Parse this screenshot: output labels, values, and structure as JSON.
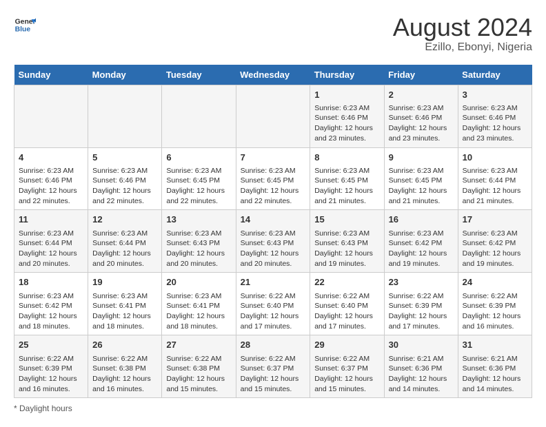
{
  "header": {
    "logo_general": "General",
    "logo_blue": "Blue",
    "main_title": "August 2024",
    "subtitle": "Ezillo, Ebonyi, Nigeria"
  },
  "calendar": {
    "days_of_week": [
      "Sunday",
      "Monday",
      "Tuesday",
      "Wednesday",
      "Thursday",
      "Friday",
      "Saturday"
    ],
    "weeks": [
      [
        {
          "day": "",
          "info": ""
        },
        {
          "day": "",
          "info": ""
        },
        {
          "day": "",
          "info": ""
        },
        {
          "day": "",
          "info": ""
        },
        {
          "day": "1",
          "info": "Sunrise: 6:23 AM\nSunset: 6:46 PM\nDaylight: 12 hours and 23 minutes."
        },
        {
          "day": "2",
          "info": "Sunrise: 6:23 AM\nSunset: 6:46 PM\nDaylight: 12 hours and 23 minutes."
        },
        {
          "day": "3",
          "info": "Sunrise: 6:23 AM\nSunset: 6:46 PM\nDaylight: 12 hours and 23 minutes."
        }
      ],
      [
        {
          "day": "4",
          "info": "Sunrise: 6:23 AM\nSunset: 6:46 PM\nDaylight: 12 hours and 22 minutes."
        },
        {
          "day": "5",
          "info": "Sunrise: 6:23 AM\nSunset: 6:46 PM\nDaylight: 12 hours and 22 minutes."
        },
        {
          "day": "6",
          "info": "Sunrise: 6:23 AM\nSunset: 6:45 PM\nDaylight: 12 hours and 22 minutes."
        },
        {
          "day": "7",
          "info": "Sunrise: 6:23 AM\nSunset: 6:45 PM\nDaylight: 12 hours and 22 minutes."
        },
        {
          "day": "8",
          "info": "Sunrise: 6:23 AM\nSunset: 6:45 PM\nDaylight: 12 hours and 21 minutes."
        },
        {
          "day": "9",
          "info": "Sunrise: 6:23 AM\nSunset: 6:45 PM\nDaylight: 12 hours and 21 minutes."
        },
        {
          "day": "10",
          "info": "Sunrise: 6:23 AM\nSunset: 6:44 PM\nDaylight: 12 hours and 21 minutes."
        }
      ],
      [
        {
          "day": "11",
          "info": "Sunrise: 6:23 AM\nSunset: 6:44 PM\nDaylight: 12 hours and 20 minutes."
        },
        {
          "day": "12",
          "info": "Sunrise: 6:23 AM\nSunset: 6:44 PM\nDaylight: 12 hours and 20 minutes."
        },
        {
          "day": "13",
          "info": "Sunrise: 6:23 AM\nSunset: 6:43 PM\nDaylight: 12 hours and 20 minutes."
        },
        {
          "day": "14",
          "info": "Sunrise: 6:23 AM\nSunset: 6:43 PM\nDaylight: 12 hours and 20 minutes."
        },
        {
          "day": "15",
          "info": "Sunrise: 6:23 AM\nSunset: 6:43 PM\nDaylight: 12 hours and 19 minutes."
        },
        {
          "day": "16",
          "info": "Sunrise: 6:23 AM\nSunset: 6:42 PM\nDaylight: 12 hours and 19 minutes."
        },
        {
          "day": "17",
          "info": "Sunrise: 6:23 AM\nSunset: 6:42 PM\nDaylight: 12 hours and 19 minutes."
        }
      ],
      [
        {
          "day": "18",
          "info": "Sunrise: 6:23 AM\nSunset: 6:42 PM\nDaylight: 12 hours and 18 minutes."
        },
        {
          "day": "19",
          "info": "Sunrise: 6:23 AM\nSunset: 6:41 PM\nDaylight: 12 hours and 18 minutes."
        },
        {
          "day": "20",
          "info": "Sunrise: 6:23 AM\nSunset: 6:41 PM\nDaylight: 12 hours and 18 minutes."
        },
        {
          "day": "21",
          "info": "Sunrise: 6:22 AM\nSunset: 6:40 PM\nDaylight: 12 hours and 17 minutes."
        },
        {
          "day": "22",
          "info": "Sunrise: 6:22 AM\nSunset: 6:40 PM\nDaylight: 12 hours and 17 minutes."
        },
        {
          "day": "23",
          "info": "Sunrise: 6:22 AM\nSunset: 6:39 PM\nDaylight: 12 hours and 17 minutes."
        },
        {
          "day": "24",
          "info": "Sunrise: 6:22 AM\nSunset: 6:39 PM\nDaylight: 12 hours and 16 minutes."
        }
      ],
      [
        {
          "day": "25",
          "info": "Sunrise: 6:22 AM\nSunset: 6:39 PM\nDaylight: 12 hours and 16 minutes."
        },
        {
          "day": "26",
          "info": "Sunrise: 6:22 AM\nSunset: 6:38 PM\nDaylight: 12 hours and 16 minutes."
        },
        {
          "day": "27",
          "info": "Sunrise: 6:22 AM\nSunset: 6:38 PM\nDaylight: 12 hours and 15 minutes."
        },
        {
          "day": "28",
          "info": "Sunrise: 6:22 AM\nSunset: 6:37 PM\nDaylight: 12 hours and 15 minutes."
        },
        {
          "day": "29",
          "info": "Sunrise: 6:22 AM\nSunset: 6:37 PM\nDaylight: 12 hours and 15 minutes."
        },
        {
          "day": "30",
          "info": "Sunrise: 6:21 AM\nSunset: 6:36 PM\nDaylight: 12 hours and 14 minutes."
        },
        {
          "day": "31",
          "info": "Sunrise: 6:21 AM\nSunset: 6:36 PM\nDaylight: 12 hours and 14 minutes."
        }
      ]
    ]
  },
  "footer": {
    "note": "Daylight hours"
  }
}
